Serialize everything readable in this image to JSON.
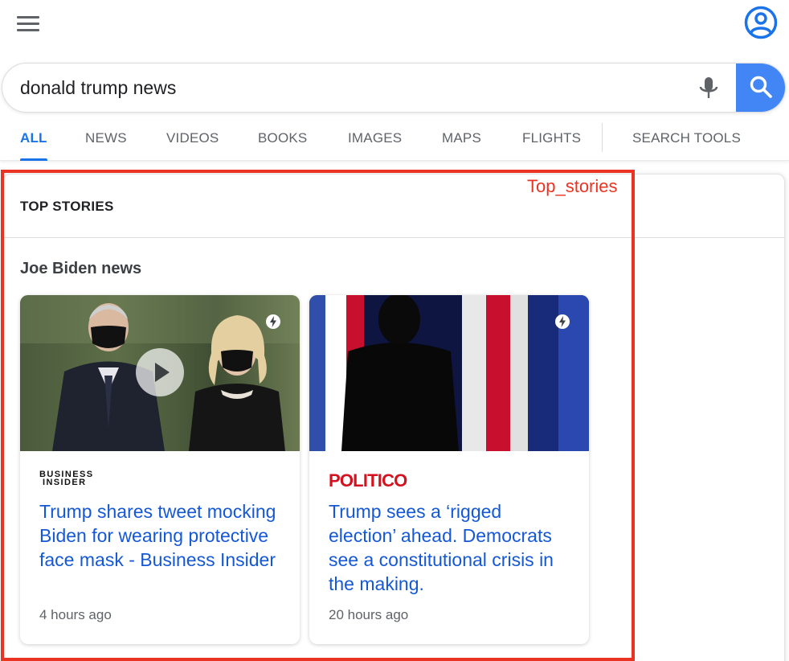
{
  "header": {
    "menu_icon": "hamburger-menu-icon",
    "account_icon": "account-circle-icon"
  },
  "search": {
    "query": "donald trump news",
    "mic_icon": "microphone-icon",
    "search_icon": "magnifier-icon",
    "accent": "#4285f4"
  },
  "tabs": [
    {
      "label": "ALL",
      "active": true
    },
    {
      "label": "NEWS"
    },
    {
      "label": "VIDEOS"
    },
    {
      "label": "BOOKS"
    },
    {
      "label": "IMAGES"
    },
    {
      "label": "MAPS"
    },
    {
      "label": "FLIGHTS"
    },
    {
      "label": "SEARCH TOOLS"
    }
  ],
  "top_stories": {
    "heading": "TOP STORIES",
    "topic": "Joe Biden news",
    "cards": [
      {
        "publisher": "BUSINESS INSIDER",
        "publisher_line1": "BUSINESS",
        "publisher_line2": "INSIDER",
        "headline": "Trump shares tweet mocking Biden for wearing protective face mask - Business Insider",
        "time": "4 hours ago",
        "has_video": true,
        "badge_icon": "amp-lightning-icon"
      },
      {
        "publisher": "POLITICO",
        "headline": "Trump sees a ‘rigged election’ ahead. Democrats see a constitutional crisis in the making.",
        "time": "20 hours ago",
        "has_video": false,
        "badge_icon": "amp-lightning-icon"
      }
    ]
  },
  "annotation": {
    "label": "Top_stories",
    "color": "#ea3323"
  }
}
